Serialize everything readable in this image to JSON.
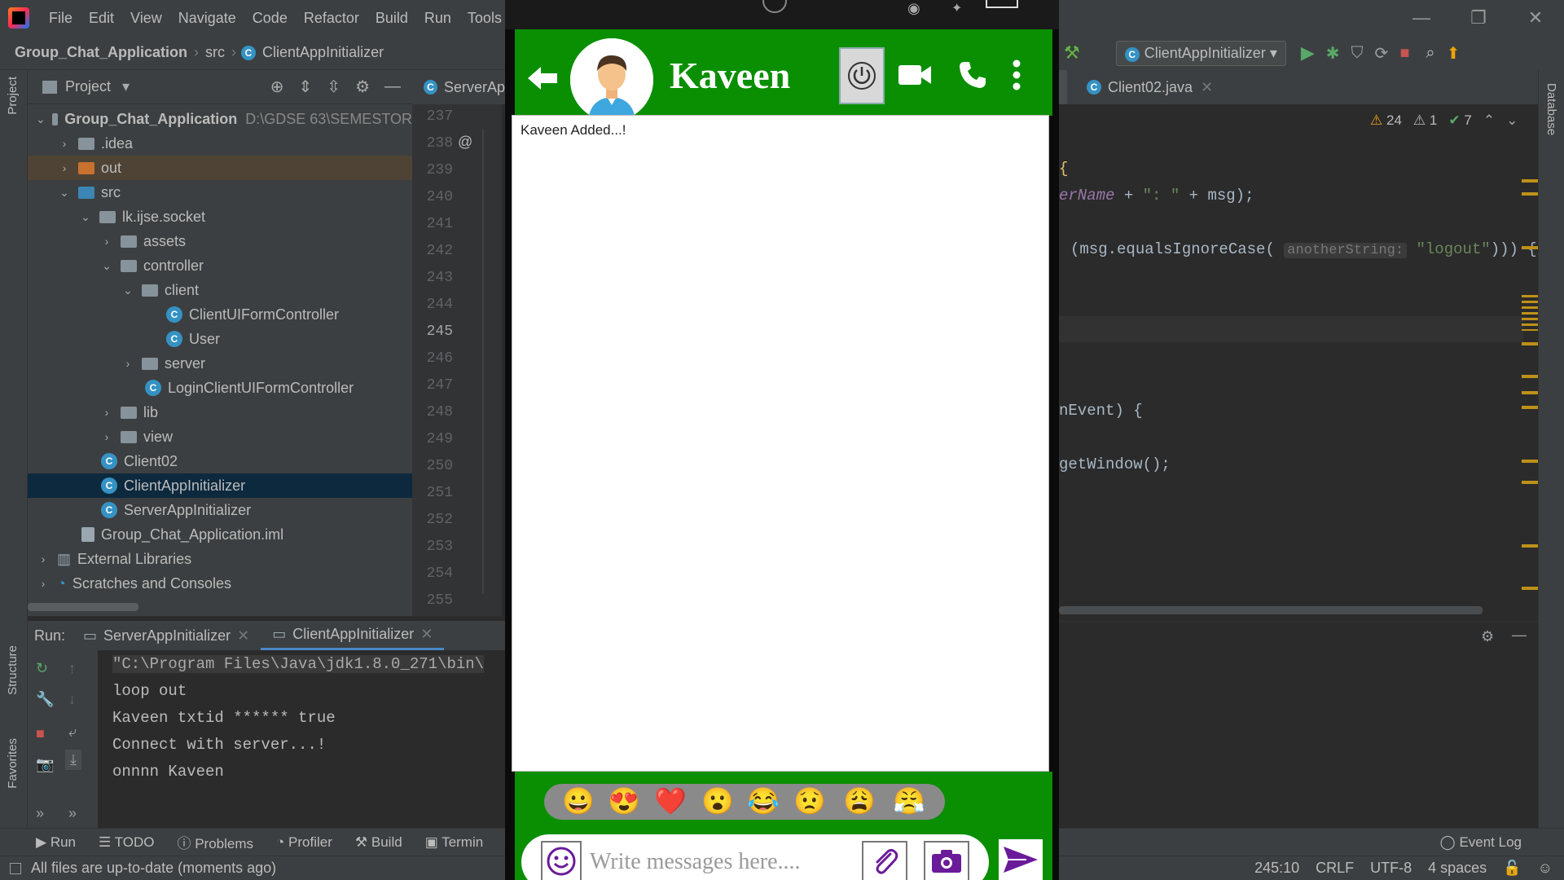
{
  "menu": {
    "items": [
      "File",
      "Edit",
      "View",
      "Navigate",
      "Code",
      "Refactor",
      "Build",
      "Run",
      "Tools",
      "V"
    ]
  },
  "window_controls": {
    "minimize": "—",
    "restore": "❐",
    "close": "✕"
  },
  "breadcrumb": {
    "project": "Group_Chat_Application",
    "folder": "src",
    "file": "ClientAppInitializer"
  },
  "project_panel": {
    "title": "Project",
    "root": {
      "name": "Group_Chat_Application",
      "path": "D:\\GDSE 63\\SEMESTOR"
    },
    "items": [
      {
        "label": ".idea"
      },
      {
        "label": "out"
      },
      {
        "label": "src"
      },
      {
        "label": "lk.ijse.socket"
      },
      {
        "label": "assets"
      },
      {
        "label": "controller"
      },
      {
        "label": "client"
      },
      {
        "label": "ClientUIFormController"
      },
      {
        "label": "User"
      },
      {
        "label": "server"
      },
      {
        "label": "LoginClientUIFormController"
      },
      {
        "label": "lib"
      },
      {
        "label": "view"
      },
      {
        "label": "Client02"
      },
      {
        "label": "ClientAppInitializer"
      },
      {
        "label": "ServerAppInitializer"
      },
      {
        "label": "Group_Chat_Application.iml"
      },
      {
        "label": "External Libraries"
      },
      {
        "label": "Scratches and Consoles"
      }
    ]
  },
  "editor": {
    "left_tab": "ServerAp",
    "right_tab": "Client02.java",
    "line_numbers": [
      "237",
      "238",
      "239",
      "240",
      "241",
      "242",
      "243",
      "244",
      "245",
      "246",
      "247",
      "248",
      "249",
      "250",
      "251",
      "252",
      "253",
      "254",
      "255"
    ],
    "inspections": {
      "warnings": "24",
      "weak": "1",
      "ok": "7"
    },
    "code": {
      "line1_a": "erName",
      "line1_b": " + ",
      "line1_c": "\": \"",
      "line1_d": " + msg);",
      "line2_a": "(msg.equalsIgnoreCase(",
      "line2_hint": "anotherString:",
      "line2_str": "\"logout\"",
      "line2_end": "))) {",
      "line3": "nEvent) {",
      "line4": "getWindow();"
    }
  },
  "toolbar": {
    "run_config": "ClientAppInitializer"
  },
  "run_panel": {
    "label": "Run:",
    "tabs": [
      "ServerAppInitializer",
      "ClientAppInitializer"
    ],
    "console": [
      "\"C:\\Program Files\\Java\\jdk1.8.0_271\\bin\\",
      "loop out",
      "Kaveen txtid ******  true",
      "Connect with server...!",
      "onnnn Kaveen"
    ]
  },
  "bottom_tabs": [
    "Run",
    "TODO",
    "Problems",
    "Profiler",
    "Build",
    "Termin"
  ],
  "event_log": "Event Log",
  "status": {
    "message": "All files are up-to-date (moments ago)",
    "position": "245:10",
    "line_sep": "CRLF",
    "encoding": "UTF-8",
    "indent": "4 spaces"
  },
  "side_labels": {
    "project": "Project",
    "structure": "Structure",
    "favorites": "Favorites",
    "database": "Database"
  },
  "chat": {
    "user_name": "Kaveen",
    "messages": [
      "Kaveen Added...!"
    ],
    "emojis": [
      "😀",
      "😍",
      "❤️",
      "😮",
      "😂",
      "😟",
      "😩",
      "😤"
    ],
    "input_placeholder": "Write messages here....",
    "colors": {
      "header": "#0a8f02",
      "accent": "#6a1b9a"
    }
  }
}
